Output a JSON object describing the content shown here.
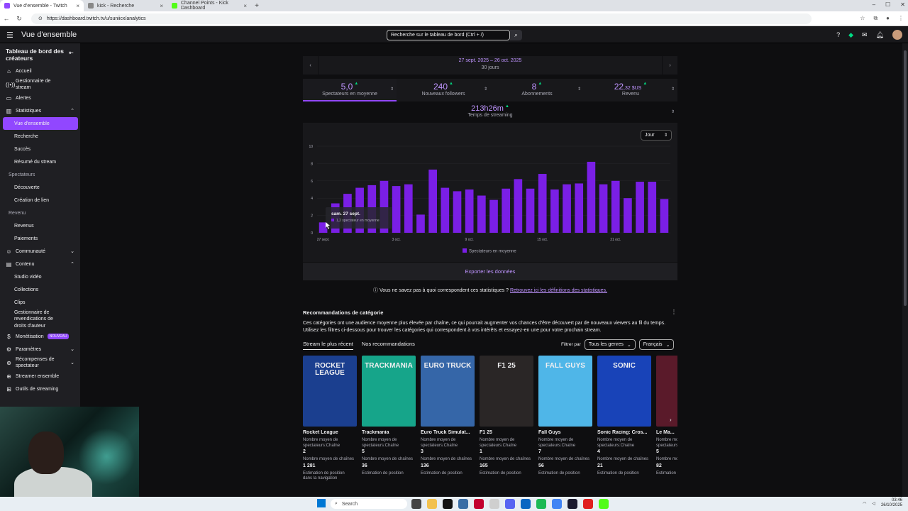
{
  "browser": {
    "tabs": [
      {
        "title": "Vue d'ensemble - Twitch",
        "active": true,
        "color": "#9147ff"
      },
      {
        "title": "kick - Recherche",
        "active": false,
        "color": "#aaaaaa"
      },
      {
        "title": "Channel Points - Kick Dashboard",
        "active": false,
        "color": "#53fc18"
      }
    ],
    "new_tab": "+",
    "url": "https://dashboard.twitch.tv/u/suniicx/analytics"
  },
  "topbar": {
    "title": "Vue d'ensemble",
    "search_placeholder": "Recherche sur le tableau de bord (Ctrl + /)"
  },
  "sidebar": {
    "heading": "Tableau de bord des créateurs",
    "items": [
      {
        "label": "Accueil",
        "icon": "home-icon",
        "kind": "top"
      },
      {
        "label": "Gestionnaire de stream",
        "icon": "stream-icon",
        "kind": "top2"
      },
      {
        "label": "Alertes",
        "icon": "alert-icon",
        "kind": "top"
      },
      {
        "label": "Statistiques",
        "icon": "stats-icon",
        "kind": "top",
        "chev": "up"
      },
      {
        "label": "Vue d'ensemble",
        "kind": "active"
      },
      {
        "label": "Recherche",
        "kind": "sub"
      },
      {
        "label": "Succès",
        "kind": "sub"
      },
      {
        "label": "Résumé du stream",
        "kind": "sub"
      },
      {
        "label": "Spectateurs",
        "kind": "sec"
      },
      {
        "label": "Découverte",
        "kind": "sub"
      },
      {
        "label": "Création de lien",
        "kind": "sub"
      },
      {
        "label": "Revenu",
        "kind": "sec"
      },
      {
        "label": "Revenus",
        "kind": "sub"
      },
      {
        "label": "Paiements",
        "kind": "sub"
      },
      {
        "label": "Communauté",
        "icon": "community-icon",
        "kind": "top",
        "chev": "down"
      },
      {
        "label": "Contenu",
        "icon": "content-icon",
        "kind": "top",
        "chev": "up"
      },
      {
        "label": "Studio vidéo",
        "kind": "sub"
      },
      {
        "label": "Collections",
        "kind": "sub"
      },
      {
        "label": "Clips",
        "kind": "sub"
      },
      {
        "label": "Gestionnaire de revendications de droits d'auteur",
        "kind": "sub3"
      },
      {
        "label": "Monétisation",
        "icon": "money-icon",
        "kind": "top",
        "badge": "NOUVEAU"
      },
      {
        "label": "Paramètres",
        "icon": "settings-icon",
        "kind": "top",
        "chev": "down"
      },
      {
        "label": "Récompenses de spectateur",
        "icon": "rewards-icon",
        "kind": "top2",
        "chev": "down"
      },
      {
        "label": "Streamer ensemble",
        "icon": "together-icon",
        "kind": "top"
      },
      {
        "label": "Outils de streaming",
        "icon": "tools-icon",
        "kind": "top"
      }
    ]
  },
  "overview": {
    "date_range": "27 sept. 2025 – 26 oct. 2025",
    "period": "30 jours",
    "stats": [
      {
        "value": "5,0",
        "unit": "",
        "label": "Spectateurs en moyenne",
        "active": true
      },
      {
        "value": "240",
        "unit": "",
        "label": "Nouveaux followers",
        "active": false
      },
      {
        "value": "8",
        "unit": "",
        "label": "Abonnements",
        "active": false
      },
      {
        "value": "22",
        "unit": ",32 $US",
        "label": "Revenu",
        "active": false
      }
    ],
    "stream_time": {
      "value": "213h26m",
      "label": "Temps de streaming"
    },
    "granularity": "Jour",
    "export_label": "Exporter les données",
    "help_text": "Vous ne savez pas à quoi correspondent ces statistiques ?",
    "help_link": "Retrouvez ici les définitions des statistiques."
  },
  "chart_data": {
    "type": "bar",
    "series": [
      {
        "name": "Spectateurs en moyenne",
        "color": "#7a1fe6",
        "values": [
          1.2,
          3.4,
          4.5,
          5.2,
          5.5,
          6.0,
          5.4,
          5.6,
          2.1,
          7.3,
          5.2,
          4.8,
          5.0,
          4.3,
          3.8,
          5.1,
          6.2,
          5.1,
          6.8,
          5.0,
          5.6,
          5.7,
          8.2,
          5.6,
          6.0,
          4.0,
          5.9,
          5.9,
          3.9
        ]
      }
    ],
    "x_ticks": [
      "27 sept.",
      "3 oct.",
      "9 oct.",
      "15 oct.",
      "21 oct."
    ],
    "y_ticks": [
      "0",
      "2",
      "4",
      "6",
      "8",
      "10"
    ],
    "ylim": [
      0,
      10
    ],
    "tooltip": {
      "title": "sam. 27 sept.",
      "text": "1,2 spectateur en moyenne"
    },
    "legend": "bottom"
  },
  "recommendations": {
    "title": "Recommandations de catégorie",
    "description": "Ces catégories ont une audience moyenne plus élevée par chaîne, ce qui pourrait augmenter vos chances d'être découvert par de nouveaux viewers au fil du temps. Utilisez les filtres ci-dessous pour trouver les catégories qui correspondent à vos intérêts et essayez-en une pour votre prochain stream.",
    "tabs": [
      "Stream le plus récent",
      "Nos recommandations"
    ],
    "filter_label": "Filtrer par",
    "filter_genre": "Tous les genres",
    "filter_lang": "Français",
    "label_avg": "Nombre moyen de spectateurs:Chaîne",
    "label_channels": "Nombre moyen de chaînes",
    "label_position": "Estimation de position",
    "cards": [
      {
        "name": "Rocket League",
        "avg": "2",
        "channels": "1 281",
        "cover": "ROCKET LEAGUE",
        "bg": "#1b3f8f"
      },
      {
        "name": "Trackmania",
        "avg": "5",
        "channels": "36",
        "cover": "TRACKMANIA",
        "bg": "#16a58a"
      },
      {
        "name": "Euro Truck Simulat...",
        "avg": "3",
        "channels": "136",
        "cover": "EURO TRUCK",
        "bg": "#3566a8"
      },
      {
        "name": "F1 25",
        "avg": "1",
        "channels": "165",
        "cover": "F1 25",
        "bg": "#2a2626"
      },
      {
        "name": "Fall Guys",
        "avg": "7",
        "channels": "56",
        "cover": "FALL GUYS",
        "bg": "#4fb6e8"
      },
      {
        "name": "Sonic Racing: Cros...",
        "avg": "4",
        "channels": "21",
        "cover": "SONIC",
        "bg": "#1843b8"
      },
      {
        "name": "Le Ma...",
        "avg": "5",
        "channels": "82",
        "cover": "",
        "bg": "#5a1a2a"
      }
    ],
    "position_extra": "dans la navigation"
  },
  "taskbar": {
    "search": "Search",
    "time": "03:46",
    "date": "26/10/2025"
  }
}
